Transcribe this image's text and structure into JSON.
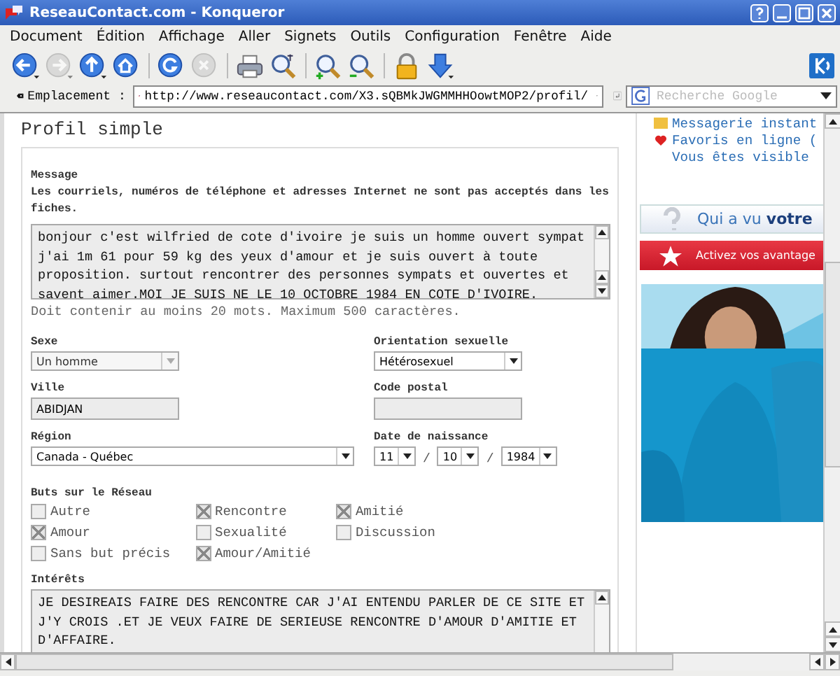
{
  "window": {
    "title": "ReseauContact.com - Konqueror"
  },
  "menu": [
    "Document",
    "Édition",
    "Affichage",
    "Aller",
    "Signets",
    "Outils",
    "Configuration",
    "Fenêtre",
    "Aide"
  ],
  "toolbar": [
    {
      "kind": "back",
      "disabled": false
    },
    {
      "kind": "forward",
      "disabled": true
    },
    {
      "kind": "up",
      "disabled": false
    },
    {
      "kind": "home",
      "disabled": false
    },
    {
      "kind": "reload",
      "disabled": false
    },
    {
      "kind": "stop",
      "disabled": true
    },
    {
      "kind": "print",
      "disabled": false
    },
    {
      "kind": "find",
      "disabled": false
    },
    {
      "kind": "zoom-in",
      "disabled": false
    },
    {
      "kind": "zoom-out",
      "disabled": false
    },
    {
      "kind": "lock",
      "disabled": false
    },
    {
      "kind": "download",
      "disabled": false
    }
  ],
  "location": {
    "label": "Emplacement :",
    "url": "http://www.reseaucontact.com/X3.sQBMkJWGMMHHOowtMOP2/profil/",
    "search": {
      "placeholder": "Recherche Google"
    }
  },
  "profile": {
    "heading": "Profil simple",
    "message": {
      "label": "Message",
      "note": "Les courriels, numéros de téléphone et adresses Internet ne sont pas acceptés dans les fiches.",
      "value": "bonjour c'est wilfried de cote d'ivoire je suis un homme ouvert sympat j'ai 1m 61 pour 59 kg des yeux d'amour et je suis ouvert à toute proposition. surtout rencontrer des personnes sympats et ouvertes et savent aimer.MOI JE SUIS NE LE 10 OCTOBRE 1984 EN COTE D'IVOIRE.",
      "hint": "Doit contenir au moins 20 mots. Maximum 500 caractères."
    },
    "sexe": {
      "label": "Sexe",
      "value": "Un homme",
      "disabled": true
    },
    "orientation": {
      "label": "Orientation sexuelle",
      "value": "Hétérosexuel",
      "disabled": false
    },
    "ville": {
      "label": "Ville",
      "value": "ABIDJAN"
    },
    "code_postal": {
      "label": "Code postal"
    },
    "region": {
      "label": "Région",
      "value": "Canada - Québec"
    },
    "birth": {
      "label": "Date de naissance",
      "day": "11",
      "month": "10",
      "year": "1984",
      "separators": [
        "/",
        "/"
      ]
    },
    "goals": {
      "label": "Buts sur le Réseau",
      "items": [
        {
          "label": "Autre",
          "checked": false
        },
        {
          "label": "Rencontre",
          "checked": true
        },
        {
          "label": "Amitié",
          "checked": true
        },
        {
          "label": "Amour",
          "checked": true
        },
        {
          "label": "Sexualité",
          "checked": false
        },
        {
          "label": "Discussion",
          "checked": false
        },
        {
          "label": "Sans but précis",
          "checked": false
        },
        {
          "label": "Amour/Amitié",
          "checked": true
        }
      ]
    },
    "interests": {
      "label": "Intérêts",
      "value": "JE DESIREAIS FAIRE DES RENCONTRE CAR J'AI ENTENDU PARLER DE CE SITE ET J'Y CROIS .ET JE VEUX FAIRE DE SERIEUSE RENCONTRE D'AMOUR D'AMITIE ET D'AFFAIRE."
    }
  },
  "sidebar": {
    "links": [
      {
        "kind": "message",
        "text": "Messagerie instant"
      },
      {
        "kind": "heart",
        "text": "Favoris en ligne ("
      },
      {
        "kind": "none",
        "text": "Vous êtes visible"
      }
    ],
    "banners": [
      {
        "kind": "question",
        "text": "Qui a vu **votre**"
      },
      {
        "kind": "star",
        "text": "Activez vos avantage"
      }
    ]
  }
}
